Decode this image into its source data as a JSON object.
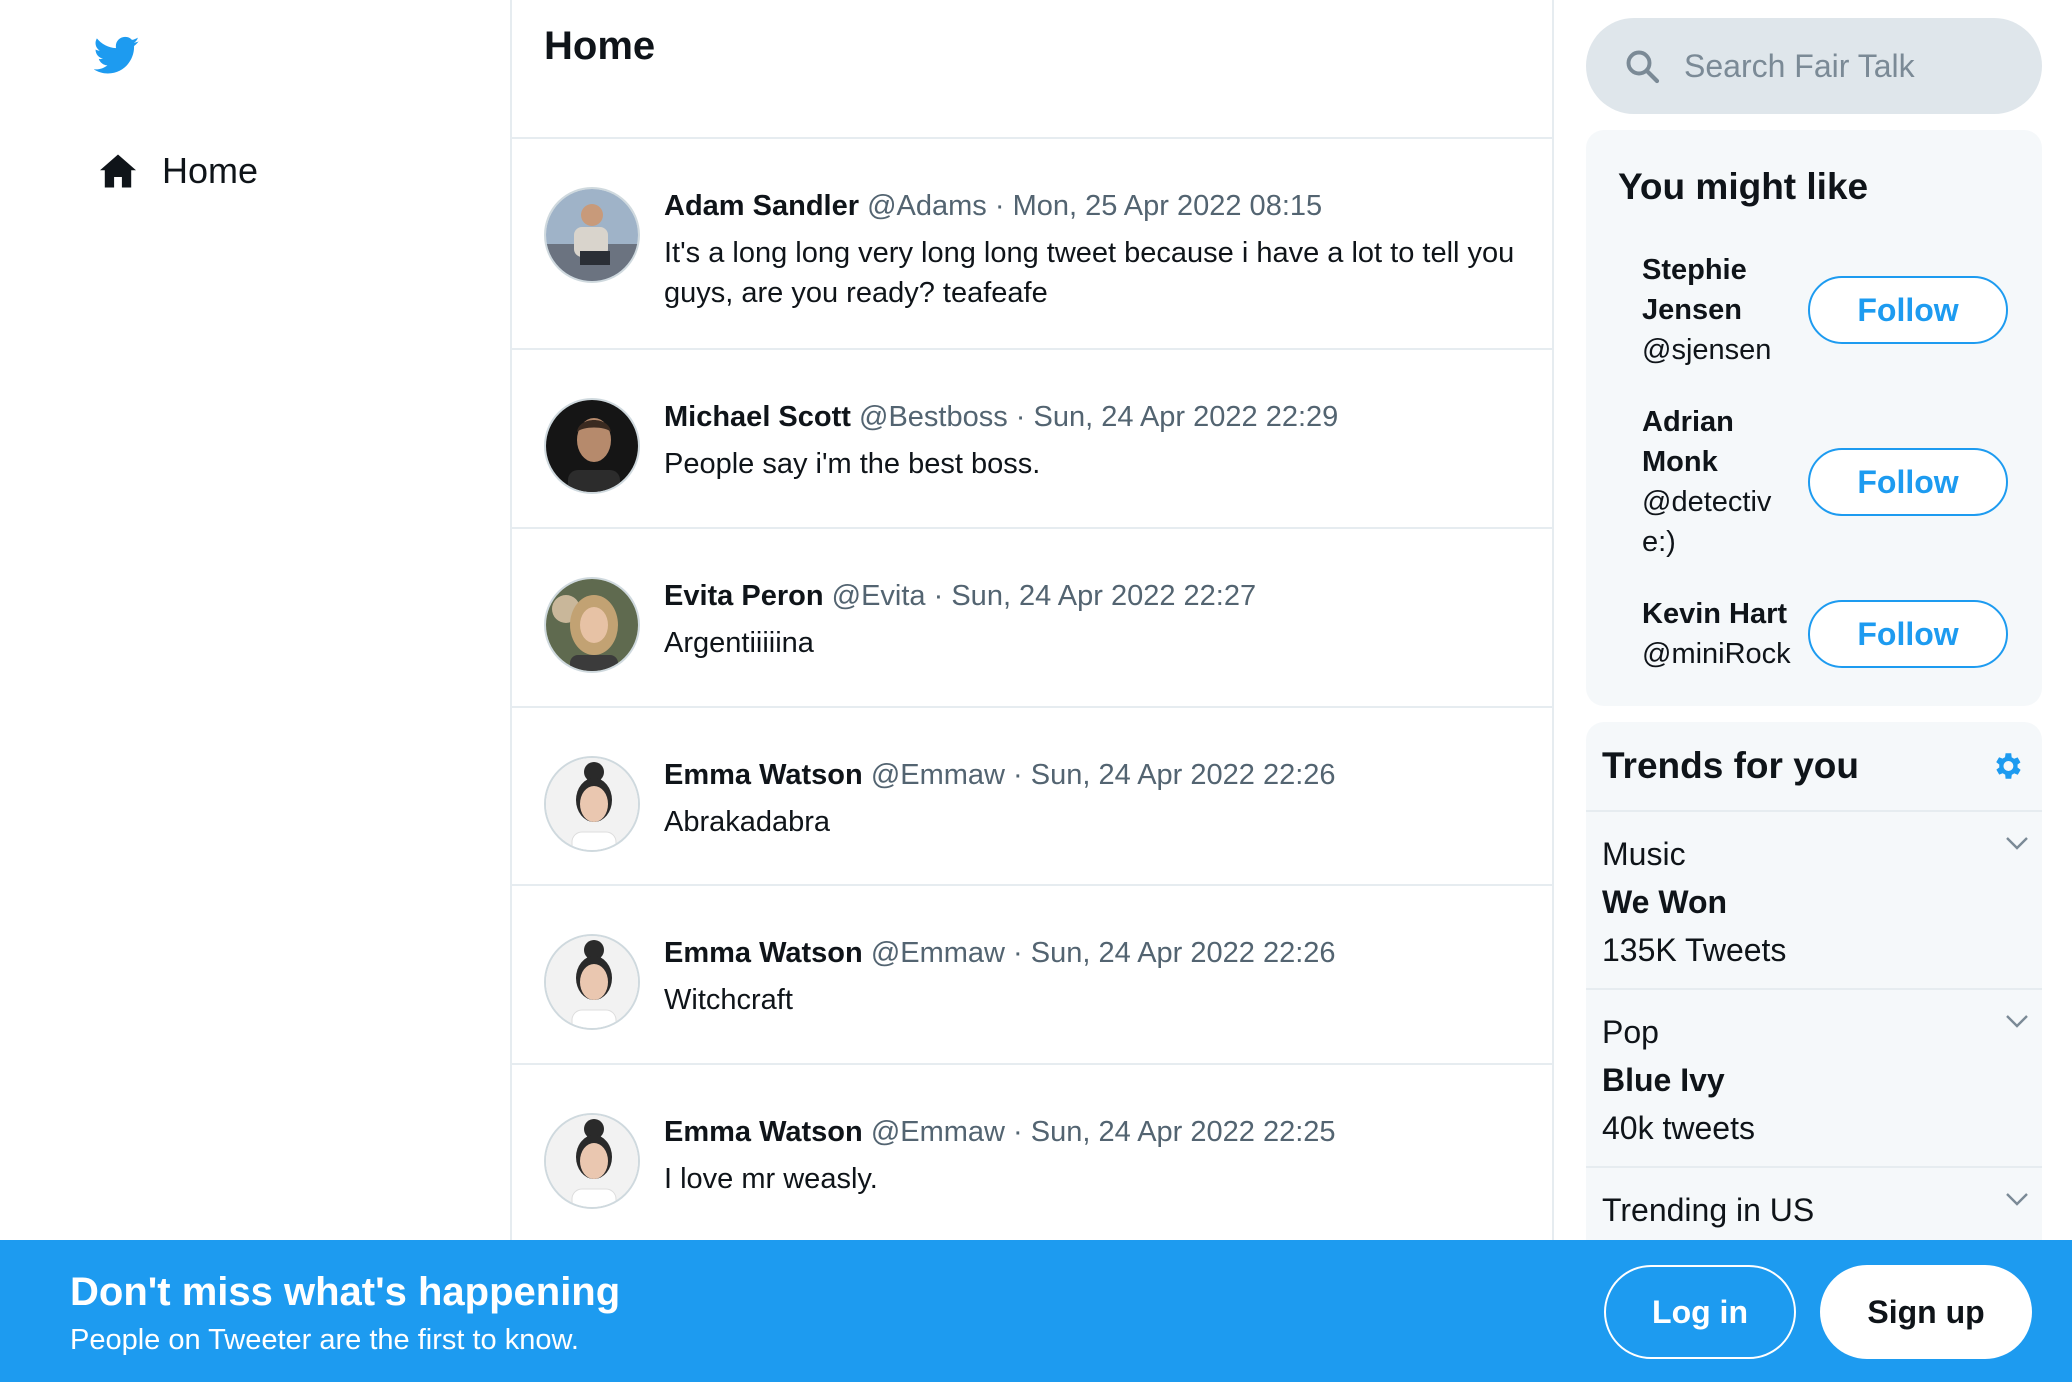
{
  "sidebar": {
    "logo_icon": "twitter-bird-icon",
    "nav": {
      "home_label": "Home",
      "home_icon": "home-icon"
    }
  },
  "feed": {
    "title": "Home",
    "tweets": [
      {
        "name": "Adam Sandler",
        "handle": "@Adams",
        "time": "Mon, 25 Apr 2022 08:15",
        "text": "It's a long long very long long tweet because i have a lot to tell you guys, are you ready? teafeafe"
      },
      {
        "name": "Michael Scott",
        "handle": "@Bestboss",
        "time": "Sun, 24 Apr 2022 22:29",
        "text": "People say i'm the best boss."
      },
      {
        "name": "Evita Peron",
        "handle": "@Evita",
        "time": "Sun, 24 Apr 2022 22:27",
        "text": "Argentiiiiina"
      },
      {
        "name": "Emma Watson",
        "handle": "@Emmaw",
        "time": "Sun, 24 Apr 2022 22:26",
        "text": "Abrakadabra"
      },
      {
        "name": "Emma Watson",
        "handle": "@Emmaw",
        "time": "Sun, 24 Apr 2022 22:26",
        "text": "Witchcraft"
      },
      {
        "name": "Emma Watson",
        "handle": "@Emmaw",
        "time": "Sun, 24 Apr 2022 22:25",
        "text": "I love mr weasly."
      }
    ],
    "separator": "·"
  },
  "search": {
    "placeholder": "Search Fair Talk"
  },
  "who_to_follow": {
    "title": "You might like",
    "follow_label": "Follow",
    "users": [
      {
        "name": "Stephie Jensen",
        "handle": "@sjensen"
      },
      {
        "name": "Adrian Monk",
        "handle": "@detective:)"
      },
      {
        "name": "Kevin Hart",
        "handle": "@miniRock"
      }
    ]
  },
  "trends": {
    "title": "Trends for you",
    "items": [
      {
        "category": "Music",
        "topic": "We Won",
        "count": "135K Tweets"
      },
      {
        "category": "Pop",
        "topic": "Blue Ivy",
        "count": "40k tweets"
      },
      {
        "category": "Trending in US",
        "topic": "",
        "count": ""
      }
    ]
  },
  "banner": {
    "headline": "Don't miss what's happening",
    "sub": "People on Tweeter are the first to know.",
    "login_label": "Log in",
    "signup_label": "Sign up"
  },
  "colors": {
    "accent": "#1d9bf0",
    "muted": "#536471",
    "panel": "#f5f8fa"
  }
}
